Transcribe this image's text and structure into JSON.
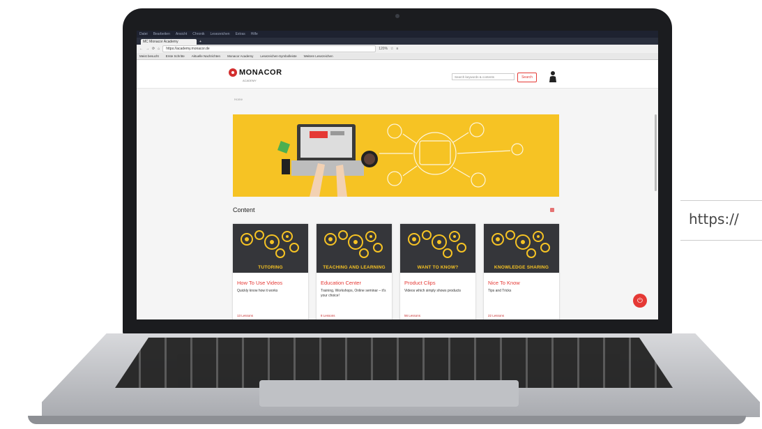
{
  "os_menu": [
    "Datei",
    "Bearbeiten",
    "Ansicht",
    "Chronik",
    "Lesezeichen",
    "Extras",
    "Hilfe"
  ],
  "browser": {
    "tab_title": "MC Monacor Academy",
    "address_url": "https://academy.monacor.de",
    "zoom_label": "120%",
    "bookmarks": [
      "Meist besucht",
      "Erste Schritte",
      "Aktuelle Nachrichten",
      "Monacor Academy",
      "Lesezeichen-Symbolleiste",
      "Weitere Lesezeichen"
    ]
  },
  "site": {
    "logo_text": "MONACOR",
    "logo_sub": "ACADEMY",
    "search_placeholder": "Search keywords & contents",
    "search_button": "Search",
    "breadcrumb": "Home"
  },
  "content": {
    "section_title": "Content",
    "cards": [
      {
        "image_label": "TUTORING",
        "title": "How To Use Videos",
        "description": "Quickly know how it works",
        "meta": "13 Lessons"
      },
      {
        "image_label": "TEACHING AND LEARNING",
        "title": "Education Center",
        "description": "Training, Workshops, Online seminar – it's your choice!",
        "meta": "8 Lessons"
      },
      {
        "image_label": "WANT TO KNOW?",
        "title": "Product Clips",
        "description": "Videos which simply shows products",
        "meta": "56 Lessons"
      },
      {
        "image_label": "KNOWLEDGE SHARING",
        "title": "Nice To Know",
        "description": "Tips and Tricks",
        "meta": "22 Lessons"
      }
    ]
  },
  "overlay": {
    "url_fragment": "https://"
  },
  "colors": {
    "accent": "#e53935",
    "banner": "#f6c324",
    "card_image_bg": "#35363a"
  }
}
